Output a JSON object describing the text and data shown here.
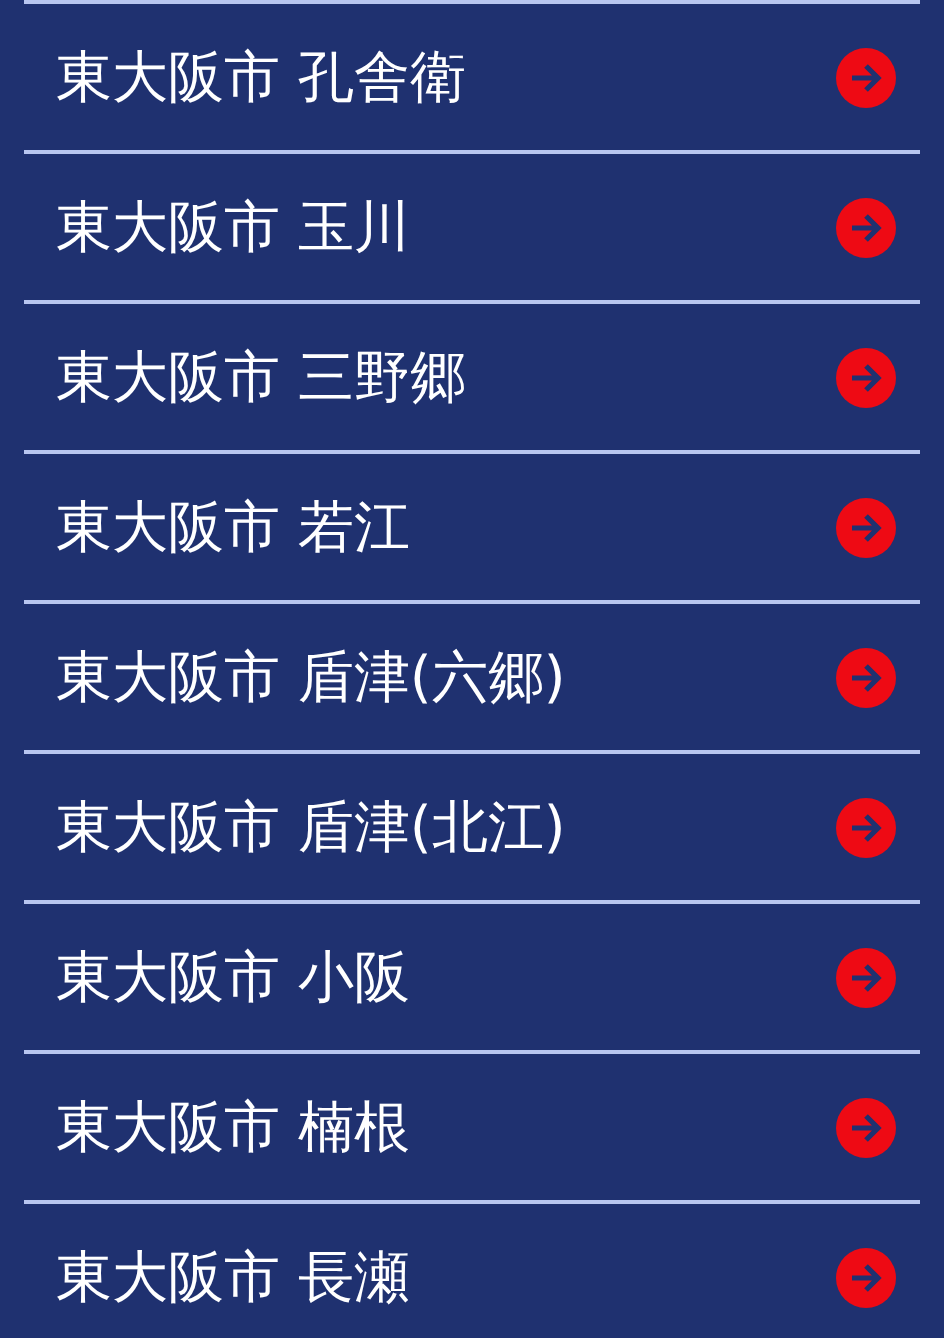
{
  "items": [
    {
      "label": "東大阪市 孔舎衛"
    },
    {
      "label": "東大阪市 玉川"
    },
    {
      "label": "東大阪市 三野郷"
    },
    {
      "label": "東大阪市 若江"
    },
    {
      "label": "東大阪市 盾津(六郷)"
    },
    {
      "label": "東大阪市 盾津(北江)"
    },
    {
      "label": "東大阪市 小阪"
    },
    {
      "label": "東大阪市 楠根"
    },
    {
      "label": "東大阪市 長瀬"
    }
  ]
}
